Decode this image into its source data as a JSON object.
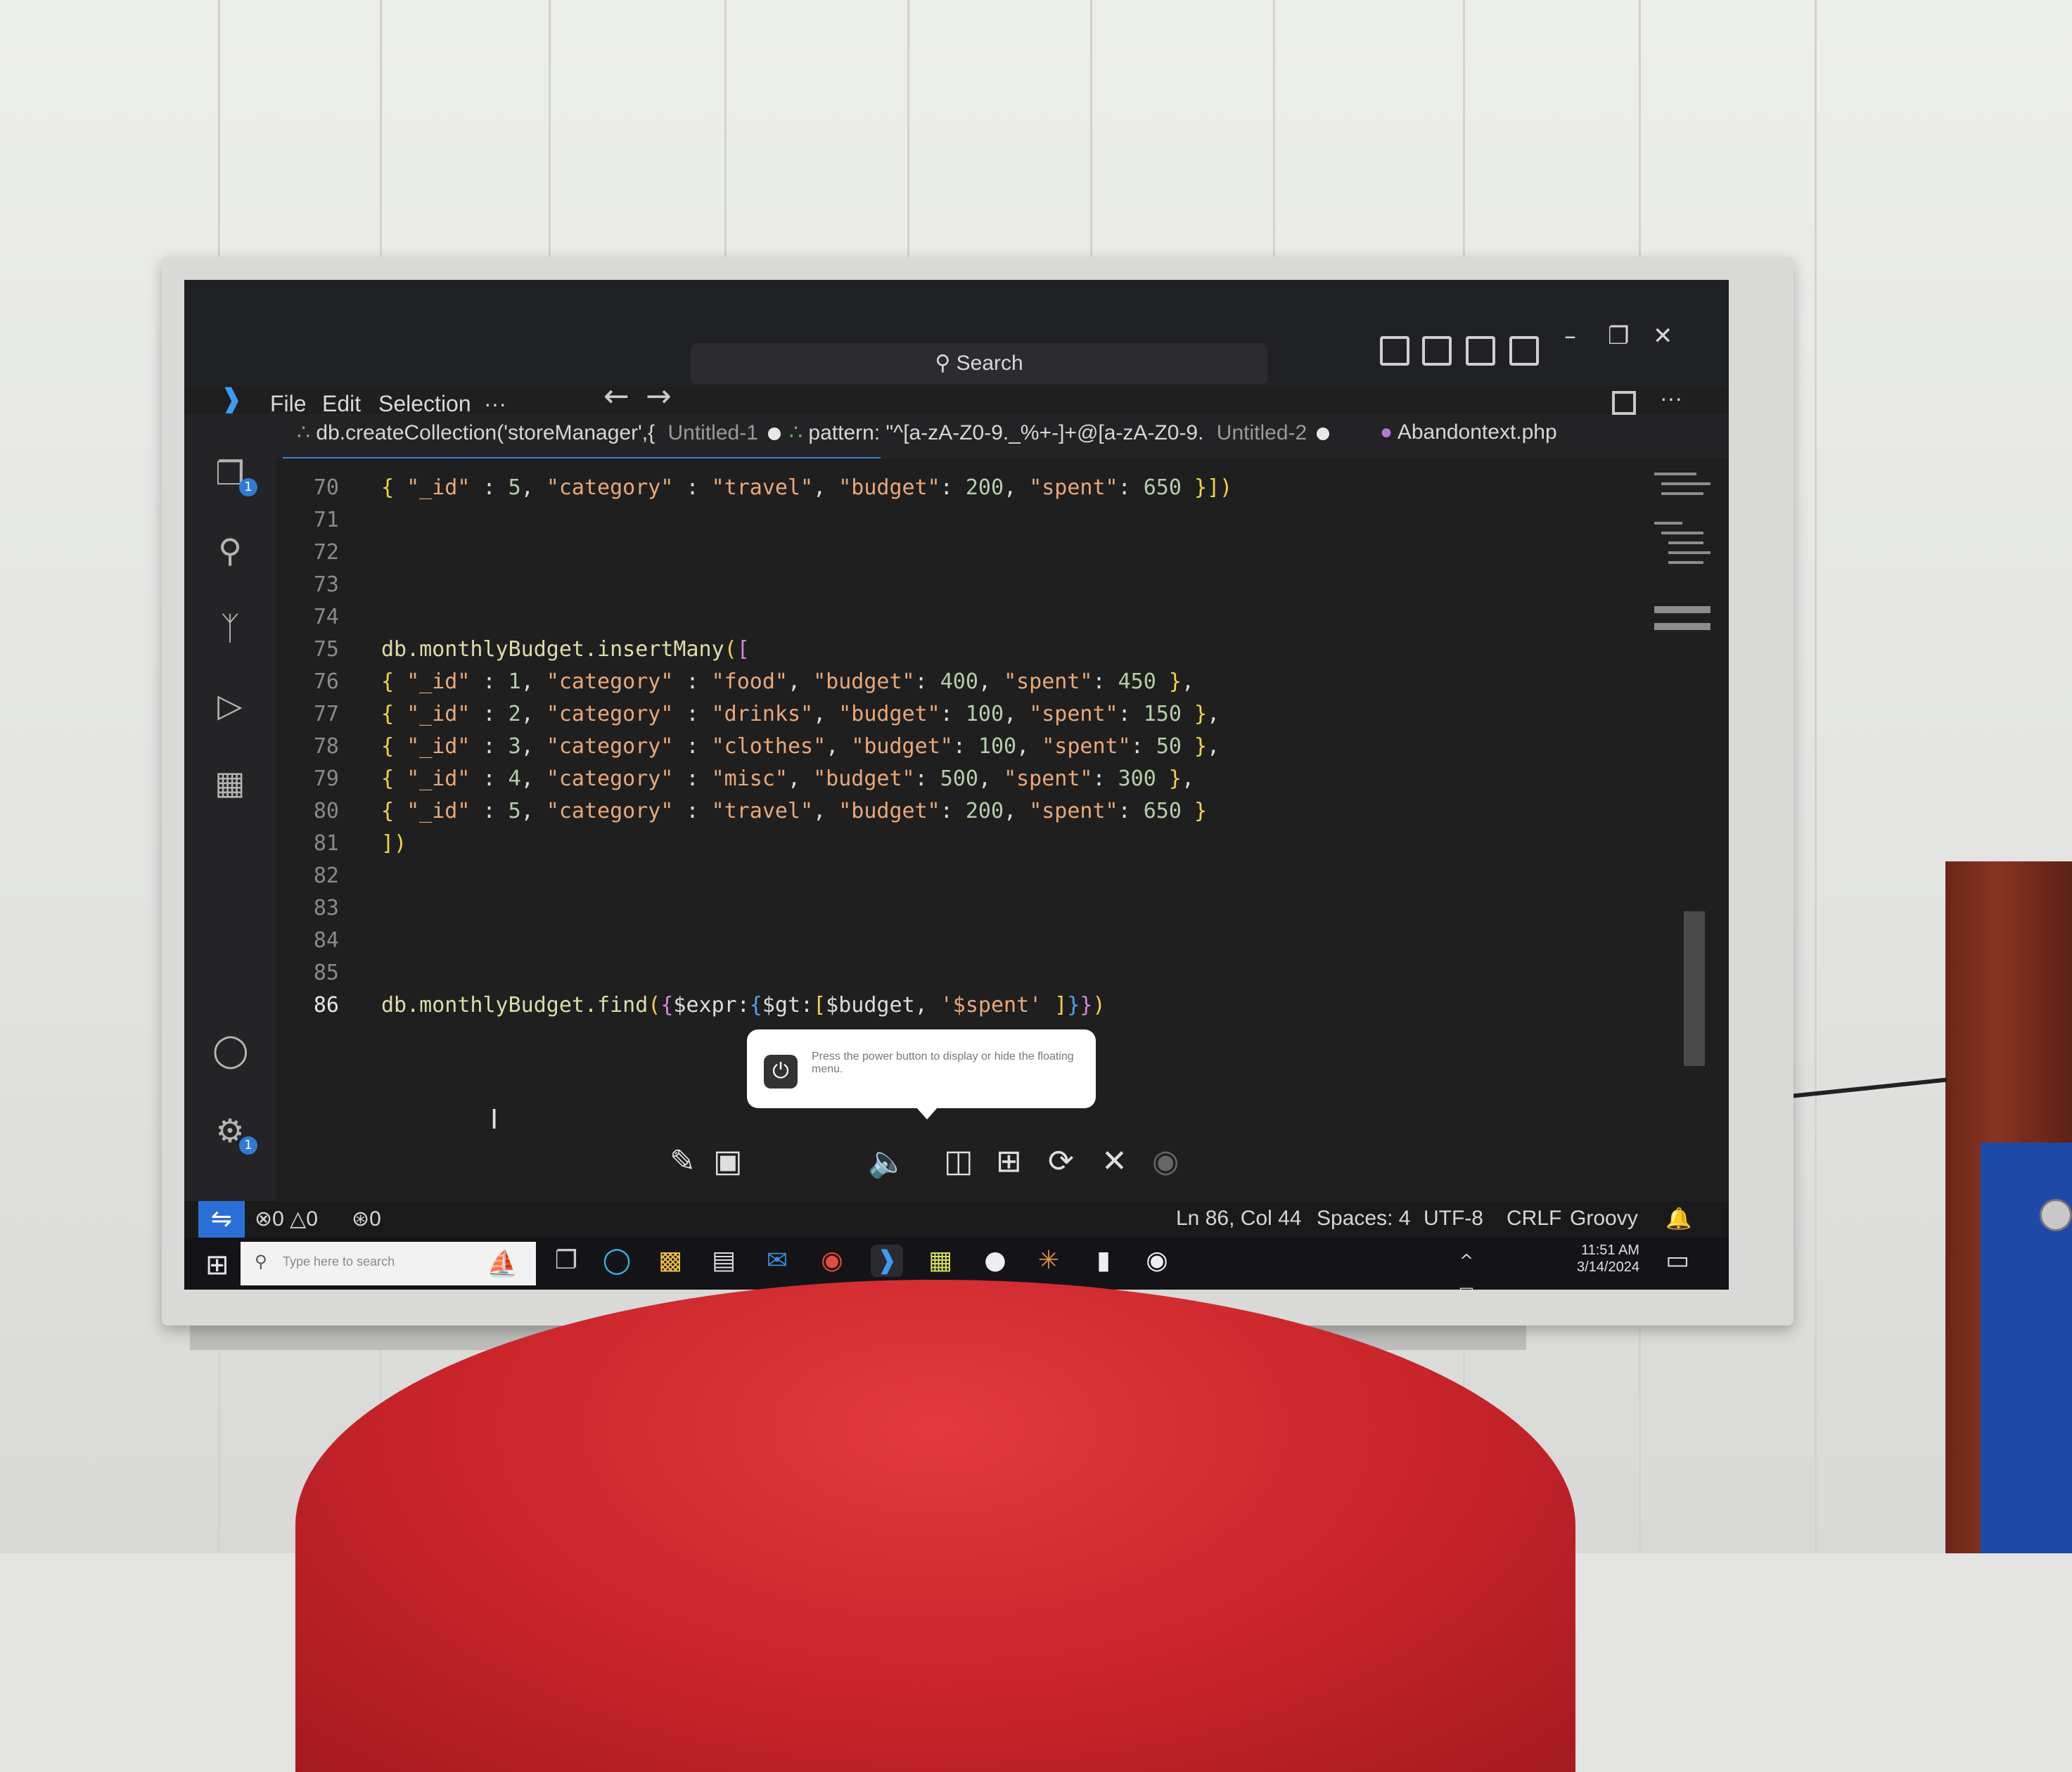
{
  "titlebar": {
    "menu": [
      "File",
      "Edit",
      "Selection",
      "···"
    ],
    "search_label": "Search"
  },
  "tabs": [
    {
      "label": "db.createCollection('storeManager',{",
      "sub": "Untitled-1",
      "dirty": true
    },
    {
      "label": "pattern: \"^[a-zA-Z0-9._%+-]+@[a-zA-Z0-9.",
      "sub": "Untitled-2",
      "dirty": true
    },
    {
      "label": "Abandontext.php",
      "sub": "",
      "dirty": false
    }
  ],
  "activity_badges": {
    "explorer": "1",
    "settings": "1"
  },
  "code": {
    "lines": [
      {
        "n": "70",
        "t": "{ \"_id\" : 5, \"category\" : \"travel\", \"budget\": 200, \"spent\": 650 }])"
      },
      {
        "n": "71",
        "t": ""
      },
      {
        "n": "72",
        "t": ""
      },
      {
        "n": "73",
        "t": ""
      },
      {
        "n": "74",
        "t": ""
      },
      {
        "n": "75",
        "t": "db.monthlyBudget.insertMany(["
      },
      {
        "n": "76",
        "t": "{ \"_id\" : 1, \"category\" : \"food\", \"budget\": 400, \"spent\": 450 },"
      },
      {
        "n": "77",
        "t": "{ \"_id\" : 2, \"category\" : \"drinks\", \"budget\": 100, \"spent\": 150 },"
      },
      {
        "n": "78",
        "t": "{ \"_id\" : 3, \"category\" : \"clothes\", \"budget\": 100, \"spent\": 50 },"
      },
      {
        "n": "79",
        "t": "{ \"_id\" : 4, \"category\" : \"misc\", \"budget\": 500, \"spent\": 300 },"
      },
      {
        "n": "80",
        "t": "{ \"_id\" : 5, \"category\" : \"travel\", \"budget\": 200, \"spent\": 650 }"
      },
      {
        "n": "81",
        "t": "])"
      },
      {
        "n": "82",
        "t": ""
      },
      {
        "n": "83",
        "t": ""
      },
      {
        "n": "84",
        "t": ""
      },
      {
        "n": "85",
        "t": ""
      },
      {
        "n": "86",
        "t": "db.monthlyBudget.find({$expr:{$gt:[$budget, '$spent' ]}})"
      }
    ],
    "current_line": "86"
  },
  "tooltip": {
    "text": "Press the power button to display or hide the floating menu."
  },
  "statusbar": {
    "errors": "0",
    "warnings": "0",
    "ports": "0",
    "position": "Ln 86, Col 44",
    "spaces": "Spaces: 4",
    "encoding": "UTF-8",
    "eol": "CRLF",
    "language": "Groovy"
  },
  "taskbar": {
    "search_placeholder": "Type here to search",
    "time": "11:51 AM",
    "date": "3/14/2024"
  },
  "colors": {
    "accent": "#2b6fd6",
    "editor_bg": "#1f1f1f",
    "string": "#e8a878",
    "number": "#b5cea8",
    "bracket_1": "#f3d24a",
    "bracket_2": "#d685d6",
    "bracket_3": "#4fa2f0"
  },
  "icons": [
    "vscode-logo-icon",
    "explorer-icon",
    "search-icon",
    "source-control-icon",
    "run-debug-icon",
    "extensions-icon",
    "account-icon",
    "settings-gear-icon",
    "remote-icon",
    "windows-start-icon"
  ]
}
